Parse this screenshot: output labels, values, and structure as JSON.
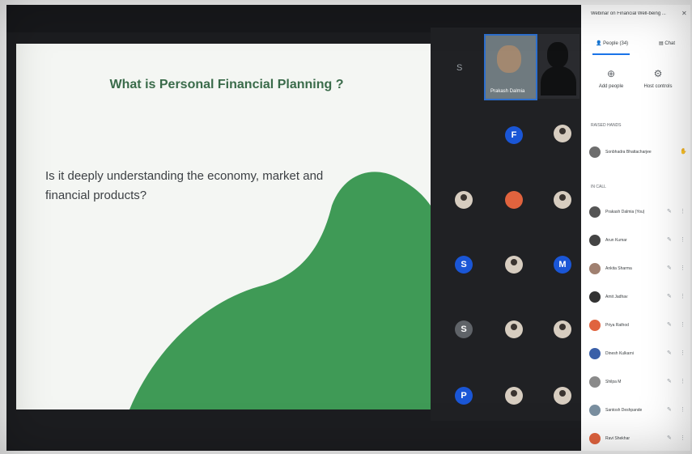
{
  "slide": {
    "title": "What is Personal Financial Planning ?",
    "body": "Is it deeply understanding the economy, market and financial products?"
  },
  "colors": {
    "slide_bg": "#f4f6f3",
    "blob_green": "#3f9a56",
    "accent_blue": "#1a73e8"
  },
  "grid": {
    "self_name": "Prakash Dalmia",
    "s_label": "S",
    "tiles": [
      {
        "kind": "blue",
        "letter": "F"
      },
      {
        "kind": "photo",
        "letter": ""
      },
      {
        "kind": "photo",
        "letter": ""
      },
      {
        "kind": "orange",
        "letter": ""
      },
      {
        "kind": "photo",
        "letter": ""
      },
      {
        "kind": "blue",
        "letter": "S"
      },
      {
        "kind": "photo",
        "letter": ""
      },
      {
        "kind": "blue",
        "letter": "M"
      },
      {
        "kind": "grey",
        "letter": "S"
      },
      {
        "kind": "photo",
        "letter": ""
      },
      {
        "kind": "photo",
        "letter": ""
      },
      {
        "kind": "blue",
        "letter": "P"
      },
      {
        "kind": "photo",
        "letter": ""
      },
      {
        "kind": "photo",
        "letter": ""
      }
    ]
  },
  "sidebar": {
    "meeting_title": "Webinar on Financial Well-being ...",
    "close_icon": "close-icon",
    "tab_people": "People (34)",
    "tab_chat": "Chat",
    "actions": [
      {
        "icon": "add-person-icon",
        "label": "Add people"
      },
      {
        "icon": "host-controls-icon",
        "label": "Host controls"
      }
    ],
    "raised_hands_label": "RAISED HANDS",
    "raised_hand": {
      "name": "Sonbhadra Bhattacharjee"
    },
    "in_call_label": "IN CALL",
    "participants": [
      {
        "name": "Prakash Dalmia (You)",
        "color": "#555555"
      },
      {
        "name": "Arun Kumar",
        "color": "#444444"
      },
      {
        "name": "Ankita Sharma",
        "color": "#a08070"
      },
      {
        "name": "Amit Jadhav",
        "color": "#333333"
      },
      {
        "name": "Priya Rathod",
        "color": "#e0633e"
      },
      {
        "name": "Dinesh Kulkarni",
        "color": "#3a5fa8"
      },
      {
        "name": "Shilpa M",
        "color": "#8a8a8a"
      },
      {
        "name": "Santosh Deshpande",
        "color": "#7a8fa0"
      },
      {
        "name": "Ravi Shekhar",
        "color": "#e0633e"
      }
    ]
  }
}
